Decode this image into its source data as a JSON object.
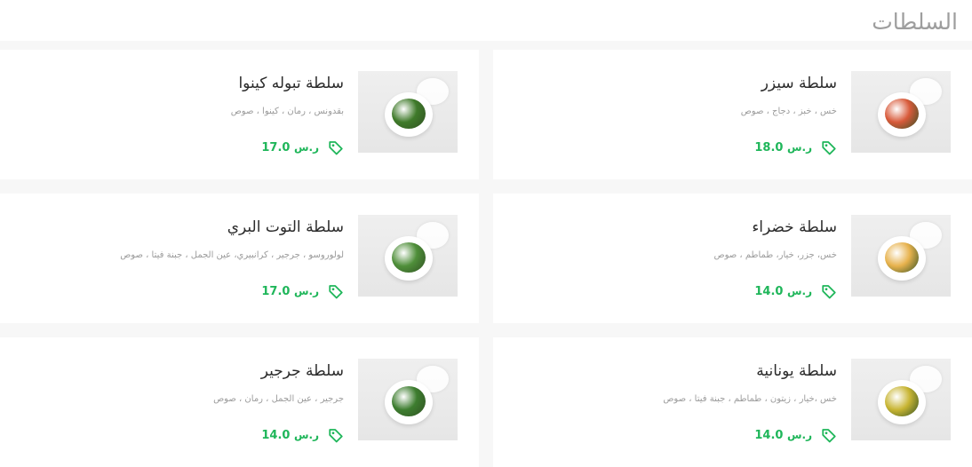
{
  "section": {
    "title": "السلطات"
  },
  "items": [
    {
      "name": "سلطة سيزر",
      "description": "خس ، خبز ، دجاج ، صوص",
      "price": "18.0",
      "currency": "ر.س",
      "food_color": "#d85a3a",
      "icon": "price-tag-icon"
    },
    {
      "name": "سلطة تبوله كينوا",
      "description": "بقدونس ، رمان ، كينوا ، صوص",
      "price": "17.0",
      "currency": "ر.س",
      "food_color": "#3f7a2a",
      "icon": "price-tag-icon"
    },
    {
      "name": "سلطة خضراء",
      "description": "خس، جزر، خيار، طماطم ، صوص",
      "price": "14.0",
      "currency": "ر.س",
      "food_color": "#e7b24d",
      "icon": "price-tag-icon"
    },
    {
      "name": "سلطة التوت البري",
      "description": "لولوروسو ، جرجير ، كرانبيري، عين الجمل ، جبنة فيتا ، صوص",
      "price": "17.0",
      "currency": "ر.س",
      "food_color": "#4f8f3a",
      "icon": "price-tag-icon"
    },
    {
      "name": "سلطة يونانية",
      "description": "خس ،خيار ، زيتون ، طماطم ، جبنة فيتا ، صوص",
      "price": "14.0",
      "currency": "ر.س",
      "food_color": "#c8b533",
      "icon": "price-tag-icon"
    },
    {
      "name": "سلطة جرجير",
      "description": "جرجير ، عين الجمل ، رمان ، صوص",
      "price": "14.0",
      "currency": "ر.س",
      "food_color": "#3d7d2f",
      "icon": "price-tag-icon"
    }
  ]
}
